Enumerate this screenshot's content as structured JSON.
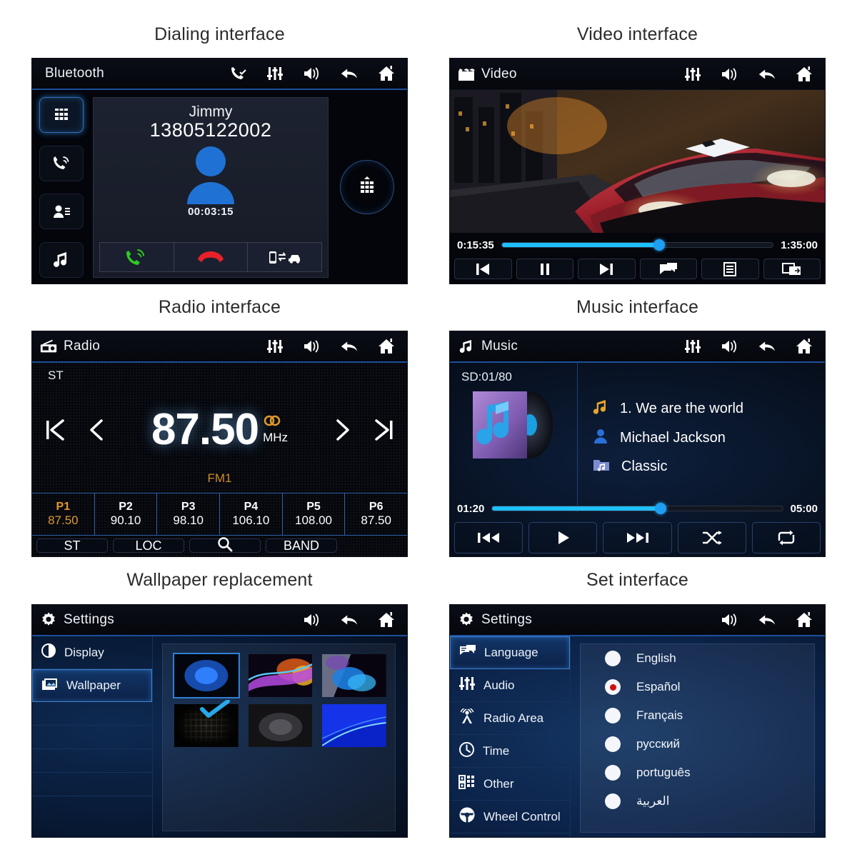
{
  "captions": {
    "dialing": "Dialing interface",
    "video": "Video interface",
    "radio": "Radio interface",
    "music": "Music interface",
    "wallpaper": "Wallpaper replacement",
    "settings": "Set interface"
  },
  "colors": {
    "accent_blue": "#1ec0ff",
    "header_underline": "#1d4f9c",
    "preset_selected": "#e0992c",
    "radio_dot_red": "#d01010",
    "answer_green": "#2ecc22",
    "hangup_red": "#e8202a"
  },
  "dialing": {
    "title": "Bluetooth",
    "header_icons": [
      "phone-check-icon",
      "equalizer-icon",
      "volume-icon",
      "back-icon",
      "home-icon"
    ],
    "sidebar": [
      {
        "name": "keypad-icon",
        "active": true
      },
      {
        "name": "call-log-icon",
        "active": false
      },
      {
        "name": "contacts-icon",
        "active": false
      },
      {
        "name": "music-note-icon",
        "active": false
      }
    ],
    "contact_name": "Jimmy",
    "contact_number": "13805122002",
    "call_duration": "00:03:15",
    "actions": [
      "answer-call-icon",
      "end-call-icon",
      "transfer-audio-icon"
    ],
    "keypad_button": "dial-pad-icon"
  },
  "video": {
    "title": "Video",
    "header_icons": [
      "equalizer-icon",
      "volume-icon",
      "back-icon",
      "home-icon"
    ],
    "elapsed": "0:15:35",
    "total": "1:35:00",
    "progress_percent": 58,
    "controls": [
      "previous-icon",
      "pause-icon",
      "next-icon",
      "subtitle-icon",
      "playlist-icon",
      "screen-share-icon"
    ]
  },
  "radio": {
    "title": "Radio",
    "header_icons": [
      "equalizer-icon",
      "volume-icon",
      "back-icon",
      "home-icon"
    ],
    "stereo_label": "ST",
    "frequency": "87.50",
    "unit": "MHz",
    "band": "FM1",
    "nav_icons": [
      "seek-start-icon",
      "tune-down-icon",
      "tune-up-icon",
      "seek-end-icon"
    ],
    "presets": [
      {
        "slot": "P1",
        "freq": "87.50",
        "selected": true
      },
      {
        "slot": "P2",
        "freq": "90.10",
        "selected": false
      },
      {
        "slot": "P3",
        "freq": "98.10",
        "selected": false
      },
      {
        "slot": "P4",
        "freq": "106.10",
        "selected": false
      },
      {
        "slot": "P5",
        "freq": "108.00",
        "selected": false
      },
      {
        "slot": "P6",
        "freq": "87.50",
        "selected": false
      }
    ],
    "bottom_buttons": [
      {
        "label": "ST",
        "icon": ""
      },
      {
        "label": "LOC",
        "icon": ""
      },
      {
        "label": "",
        "icon": "search-icon"
      },
      {
        "label": "BAND",
        "icon": ""
      }
    ]
  },
  "music": {
    "title": "Music",
    "header_icons": [
      "equalizer-icon",
      "volume-icon",
      "back-icon",
      "home-icon"
    ],
    "source": "SD:01/80",
    "track_title": "1.  We are the world",
    "artist": "Michael Jackson",
    "album": "Classic",
    "elapsed": "01:20",
    "total": "05:00",
    "progress_percent": 58,
    "controls": [
      "previous-track-icon",
      "play-icon",
      "next-track-icon",
      "shuffle-icon",
      "repeat-icon"
    ]
  },
  "wallpaper_settings": {
    "title": "Settings",
    "header_icons": [
      "volume-icon",
      "back-icon",
      "home-icon"
    ],
    "menu": [
      {
        "label": "Display",
        "icon": "contrast-icon",
        "active": false
      },
      {
        "label": "Wallpaper",
        "icon": "image-icon",
        "active": true
      }
    ],
    "thumbnails": [
      {
        "id": "wp-1",
        "selected": true
      },
      {
        "id": "wp-2",
        "selected": false
      },
      {
        "id": "wp-3",
        "selected": false
      },
      {
        "id": "wp-4",
        "selected": false
      },
      {
        "id": "wp-5",
        "selected": false
      },
      {
        "id": "wp-6",
        "selected": false
      }
    ],
    "check_icon": "check-icon"
  },
  "set_settings": {
    "title": "Settings",
    "header_icons": [
      "volume-icon",
      "back-icon",
      "home-icon"
    ],
    "menu": [
      {
        "label": "Language",
        "icon": "chat-bubbles-icon",
        "active": true
      },
      {
        "label": "Audio",
        "icon": "equalizer-icon",
        "active": false
      },
      {
        "label": "Radio Area",
        "icon": "radio-tower-icon",
        "active": false
      },
      {
        "label": "Time",
        "icon": "clock-icon",
        "active": false
      },
      {
        "label": "Other",
        "icon": "grid-list-icon",
        "active": false
      },
      {
        "label": "Wheel Control",
        "icon": "steering-wheel-icon",
        "active": false
      }
    ],
    "languages": [
      {
        "label": "English",
        "selected": false
      },
      {
        "label": "Español",
        "selected": true
      },
      {
        "label": "Français",
        "selected": false
      },
      {
        "label": "русский",
        "selected": false
      },
      {
        "label": "português",
        "selected": false
      },
      {
        "label": "العربية",
        "selected": false
      }
    ]
  }
}
